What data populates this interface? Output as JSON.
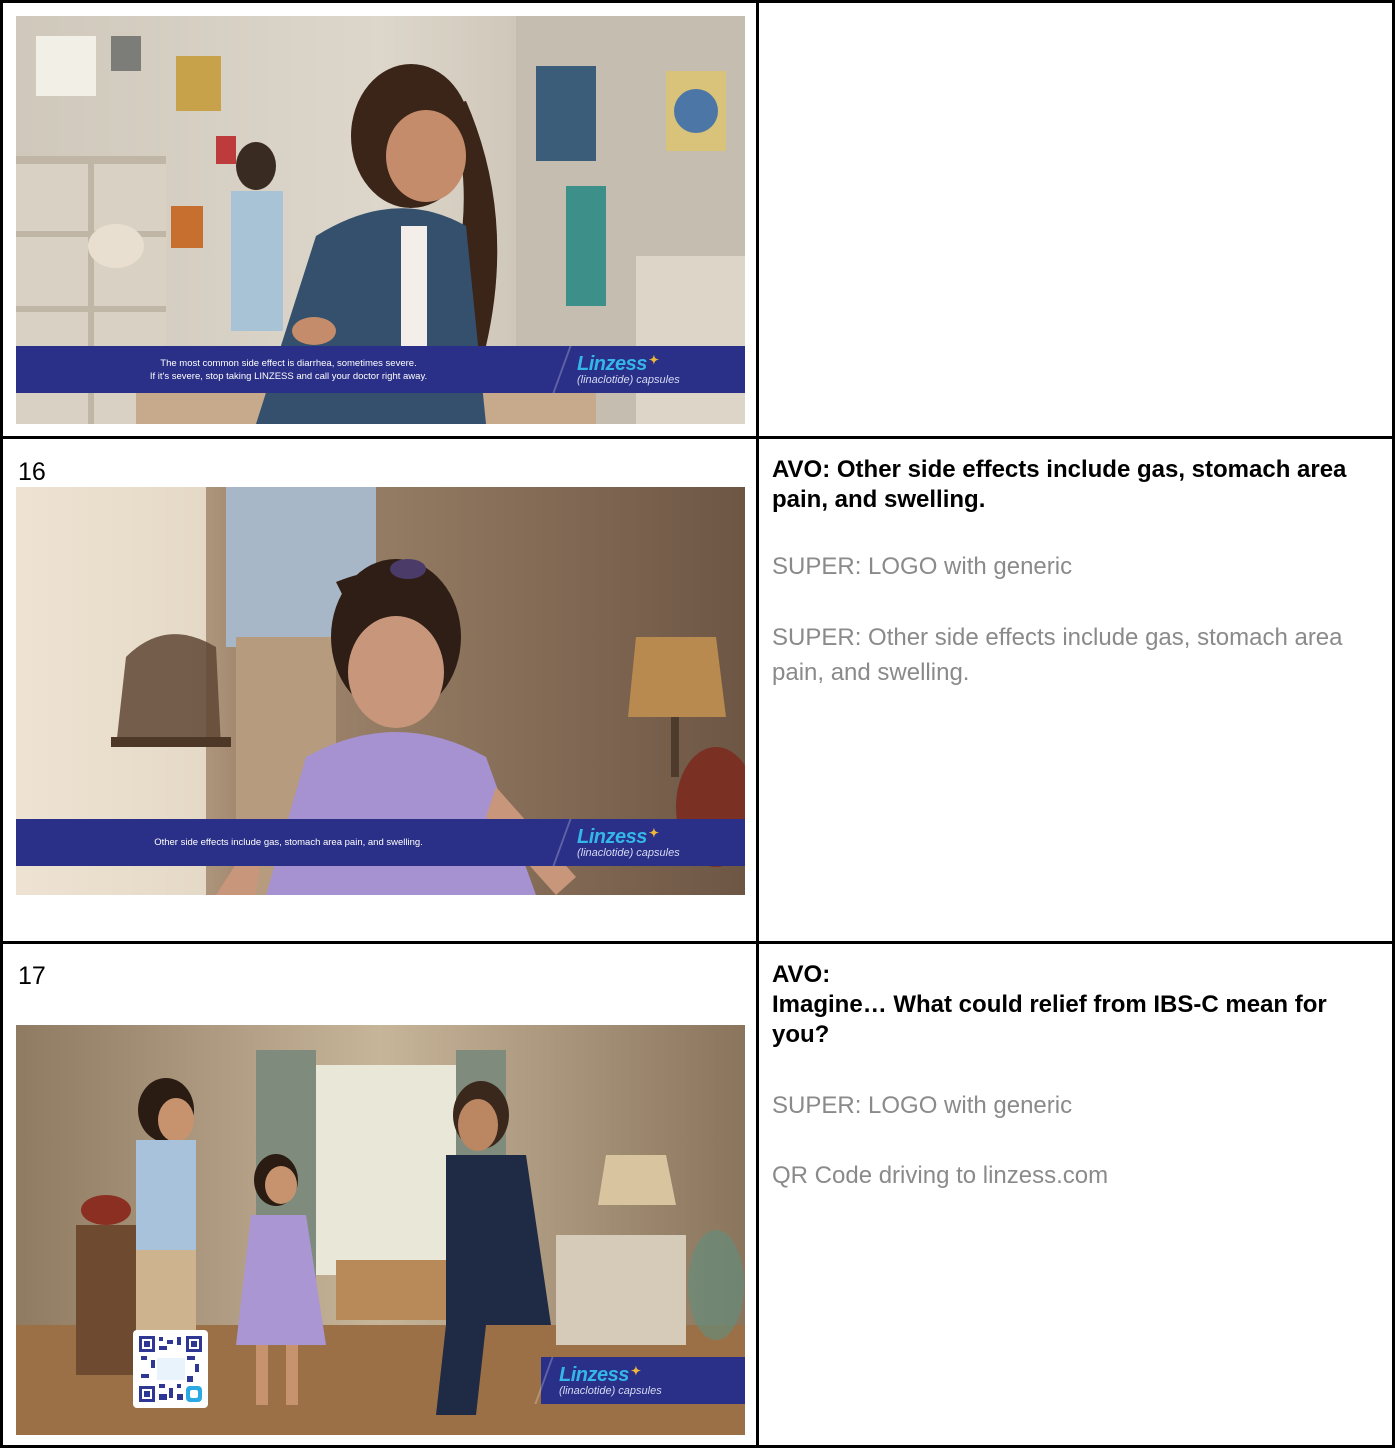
{
  "rows": [
    {
      "number": "",
      "frame": {
        "super_line1": "The most common side effect is diarrhea, sometimes severe.",
        "super_line2": "If it's severe, stop taking LINZESS and call your doctor right away."
      },
      "avo": "",
      "supers": []
    },
    {
      "number": "16",
      "frame": {
        "super_line1": "Other side effects include gas, stomach area pain, and swelling."
      },
      "avo": "AVO: Other side effects include gas, stomach area pain, and swelling.",
      "supers": [
        "SUPER: LOGO with generic",
        "SUPER: Other side effects include gas, stomach area pain, and swelling."
      ]
    },
    {
      "number": "17",
      "frame": {},
      "avo_label": "AVO:",
      "avo": "Imagine… What could relief from IBS-C mean for you?",
      "supers": [
        "SUPER: LOGO with generic",
        "QR Code driving to linzess.com"
      ]
    }
  ],
  "logo": {
    "brand": "Linzess",
    "generic": "(linaclotide) capsules"
  },
  "colors": {
    "band": "#2a2f87",
    "logo_brand": "#35b6ea",
    "super_text": "#8a8a8a"
  }
}
